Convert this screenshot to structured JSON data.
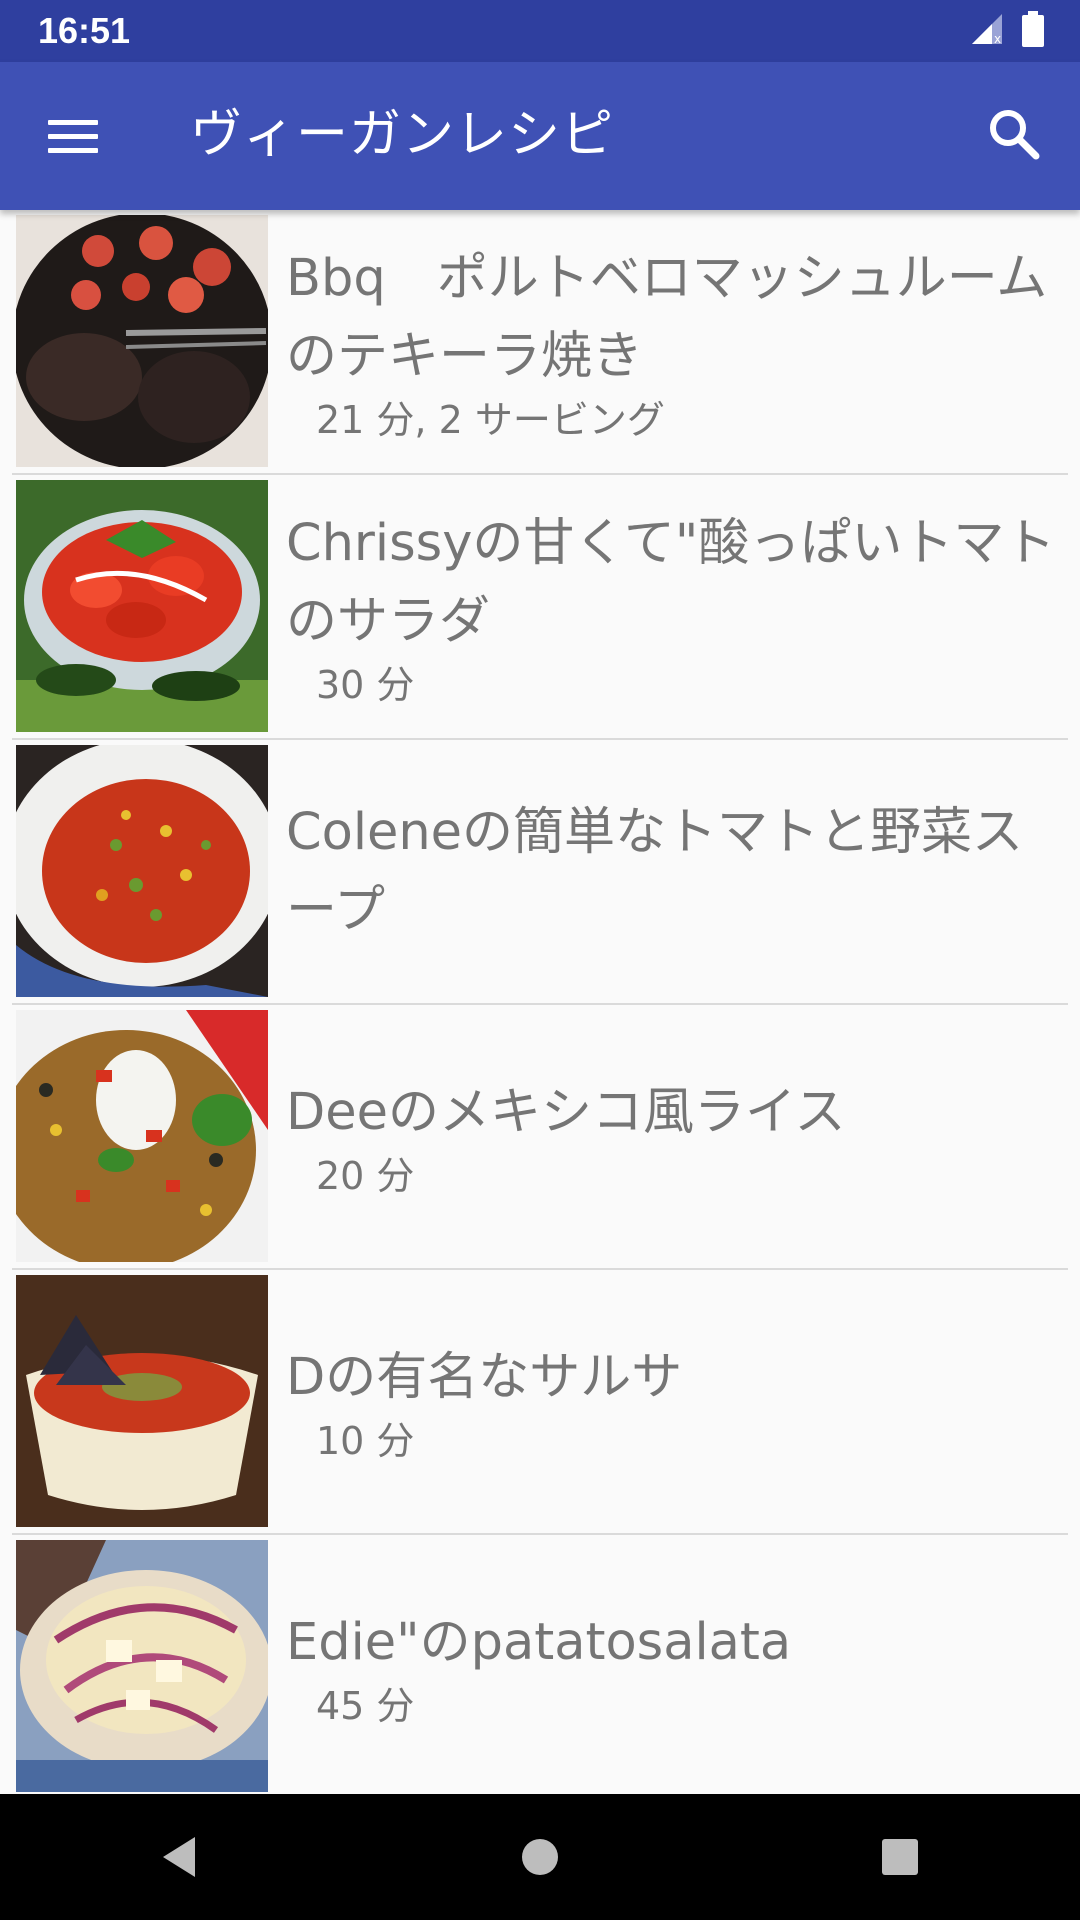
{
  "status_bar": {
    "time": "16:51",
    "signal_icon": "signal-icon",
    "battery_icon": "battery-icon"
  },
  "app_bar": {
    "title": "ヴィーガンレシピ",
    "menu_icon": "menu-icon",
    "search_icon": "search-icon"
  },
  "recipes": [
    {
      "title": "Bbq　ポルトベロマッシュルームのテキーラ焼き",
      "meta": "21 分, 2 サービング"
    },
    {
      "title": "Chrissyの甘くて\"酸っぱいトマトのサラダ",
      "meta": "30 分"
    },
    {
      "title": "Coleneの簡単なトマトと野菜スープ",
      "meta": ""
    },
    {
      "title": "Deeのメキシコ風ライス",
      "meta": "20 分"
    },
    {
      "title": "Dの有名なサルサ",
      "meta": "10 分"
    },
    {
      "title": "Edie\"のpatatosalata",
      "meta": "45 分"
    }
  ],
  "nav_bar": {
    "back_icon": "back-icon",
    "home_icon": "home-icon",
    "recents_icon": "recents-icon"
  }
}
